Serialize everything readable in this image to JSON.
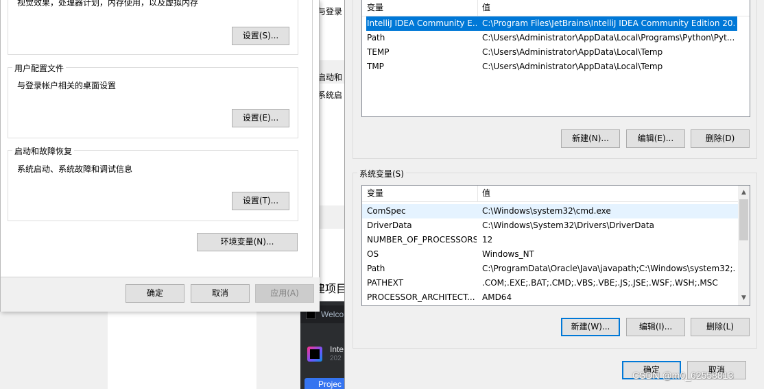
{
  "background": {
    "mid_strip_texts": [
      "与登录",
      "启动和",
      "系统启"
    ],
    "project_label": "建项目",
    "ide_welcome": "Welco",
    "ide_item_line1": "Inte",
    "ide_item_line2": "202",
    "ide_projects": "Projec"
  },
  "performance_section": {
    "desc": "视觉效果，处理器计划，内存使用，以及虚拟内存",
    "settings_button": "设置(S)..."
  },
  "user_profile_section": {
    "title": "用户配置文件",
    "desc": "与登录帐户相关的桌面设置",
    "settings_button": "设置(E)..."
  },
  "startup_section": {
    "title": "启动和故障恢复",
    "desc": "系统启动、系统故障和调试信息",
    "settings_button": "设置(T)..."
  },
  "env_vars_button": "环境变量(N)...",
  "left_footer": {
    "ok": "确定",
    "cancel": "取消",
    "apply": "应用(A)"
  },
  "user_vars": {
    "headers": {
      "variable": "变量",
      "value": "值"
    },
    "rows": [
      {
        "variable": "IntelliJ IDEA Community E...",
        "value": "C:\\Program Files\\JetBrains\\IntelliJ IDEA Community Edition 20...",
        "selected": true
      },
      {
        "variable": "Path",
        "value": "C:\\Users\\Administrator\\AppData\\Local\\Programs\\Python\\Pyt..."
      },
      {
        "variable": "TEMP",
        "value": "C:\\Users\\Administrator\\AppData\\Local\\Temp"
      },
      {
        "variable": "TMP",
        "value": "C:\\Users\\Administrator\\AppData\\Local\\Temp"
      }
    ],
    "buttons": {
      "new": "新建(N)...",
      "edit": "编辑(E)...",
      "delete": "删除(D)"
    }
  },
  "system_vars": {
    "title": "系统变量(S)",
    "headers": {
      "variable": "变量",
      "value": "值"
    },
    "rows": [
      {
        "variable": "ComSpec",
        "value": "C:\\Windows\\system32\\cmd.exe"
      },
      {
        "variable": "DriverData",
        "value": "C:\\Windows\\System32\\Drivers\\DriverData"
      },
      {
        "variable": "NUMBER_OF_PROCESSORS",
        "value": "12"
      },
      {
        "variable": "OS",
        "value": "Windows_NT"
      },
      {
        "variable": "Path",
        "value": "C:\\ProgramData\\Oracle\\Java\\javapath;C:\\Windows\\system32;..."
      },
      {
        "variable": "PATHEXT",
        "value": ".COM;.EXE;.BAT;.CMD;.VBS;.VBE;.JS;.JSE;.WSF;.WSH;.MSC"
      },
      {
        "variable": "PROCESSOR_ARCHITECT...",
        "value": "AMD64"
      }
    ],
    "buttons": {
      "new": "新建(W)...",
      "edit": "编辑(I)...",
      "delete": "删除(L)"
    }
  },
  "right_footer": {
    "ok": "确定",
    "cancel": "取消"
  },
  "watermark": "CSDN @m0_62558813",
  "colors": {
    "selection": "#0078d7",
    "focus_border": "#0078d7",
    "button_face": "#e1e1e1"
  }
}
